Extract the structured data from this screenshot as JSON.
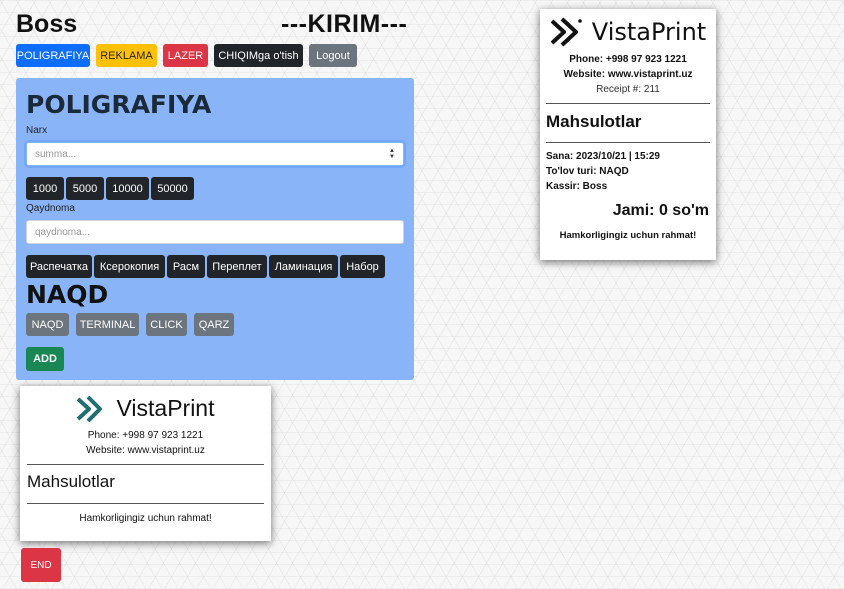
{
  "header": {
    "user": "Boss",
    "mode": "---KIRIM---"
  },
  "nav": {
    "poligrafiya": "POLIGRAFIYA",
    "reklama": "REKLAMA",
    "lazer": "LAZER",
    "chiqim": "CHIQIMga o'tish",
    "logout": "Logout"
  },
  "form": {
    "title": "POLIGRAFIYA",
    "price_label": "Narx",
    "price_placeholder": "summa...",
    "amounts": [
      "1000",
      "5000",
      "10000",
      "50000"
    ],
    "note_label": "Qaydnoma",
    "note_placeholder": "qaydnoma...",
    "services": [
      "Распечатка",
      "Ксерокопия",
      "Расм",
      "Переплет",
      "Ламинация",
      "Набор"
    ],
    "payment_title": "NAQD",
    "payments": [
      "NAQD",
      "TERMINAL",
      "CLICK",
      "QARZ"
    ],
    "add_label": "ADD"
  },
  "receipt_main": {
    "brand": "VistaPrint",
    "phone": "Phone: +998 97 923 1221",
    "website": "Website: www.vistaprint.uz",
    "receipt_no": "Receipt #: 211",
    "heading": "Mahsulotlar",
    "date": "Sana: 2023/10/21 | 15:29",
    "payment_type": "To'lov turi: NAQD",
    "cashier": "Kassir: Boss",
    "total": "Jami: 0 so'm",
    "thanks": "Hamkorligingiz uchun rahmat!"
  },
  "receipt_preview": {
    "brand": "VistaPrint",
    "phone": "Phone: +998 97 923 1221",
    "website": "Website: www.vistaprint.uz",
    "heading": "Mahsulotlar",
    "thanks": "Hamkorligingiz uchun rahmat!"
  },
  "end_label": "END",
  "colors": {
    "panel": "#8ab4f8",
    "primary": "#0d6efd",
    "warning": "#ffc107",
    "danger": "#dc3545",
    "dark": "#212529",
    "secondary": "#6c757d",
    "success": "#198754",
    "logo": "#1f6f70"
  }
}
